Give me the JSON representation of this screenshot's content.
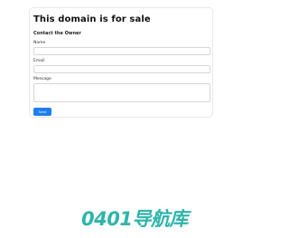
{
  "card": {
    "title": "This domain is for sale",
    "subtitle": "Contact the Owner",
    "name_label": "Name",
    "email_label": "Email",
    "message_label": "Message",
    "send_label": "Send"
  },
  "brand": {
    "logo_text": "0401导航库",
    "color": "#2fb5ab"
  },
  "colors": {
    "accent": "#1e7ef0"
  }
}
